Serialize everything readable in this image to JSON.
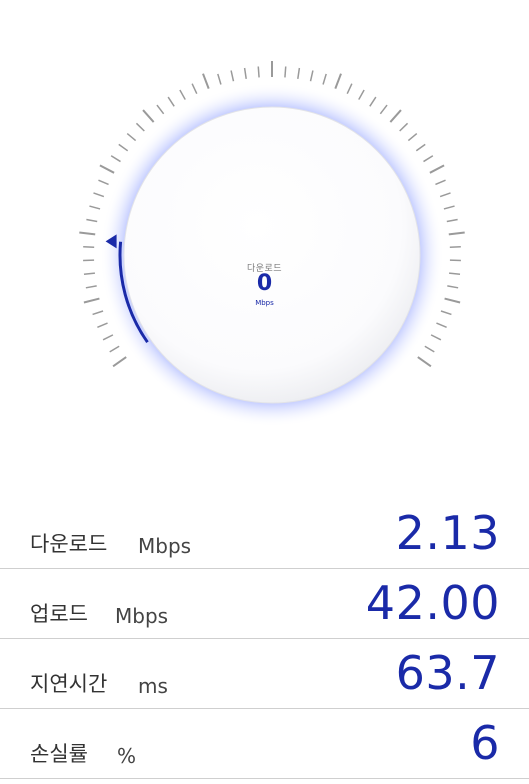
{
  "gauge": {
    "label": "다운로드",
    "value": "0",
    "unit": "Mbps",
    "accent_color": "#1a2aa8",
    "glow_color": "#3f5cff",
    "tick_color": "#9a9a9a",
    "needle_level": 0
  },
  "results": [
    {
      "label": "다운로드",
      "unit": "Mbps",
      "value": "2.13"
    },
    {
      "label": "업로드",
      "unit": "Mbps",
      "value": "42.00"
    },
    {
      "label": "지연시간",
      "unit": "ms",
      "value": "63.7"
    },
    {
      "label": "손실률",
      "unit": "%",
      "value": "6"
    }
  ]
}
